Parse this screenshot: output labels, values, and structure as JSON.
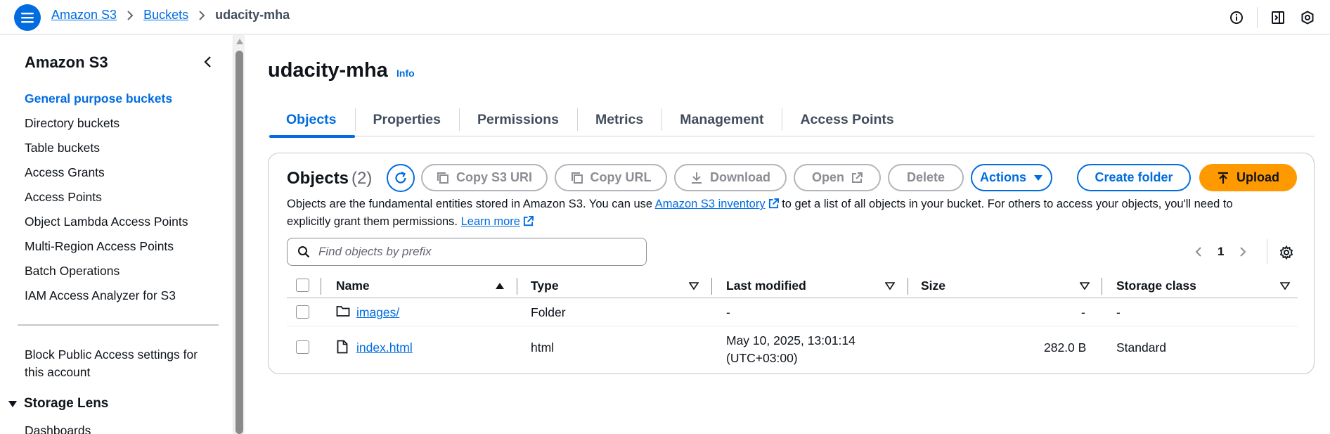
{
  "header": {
    "breadcrumb": [
      "Amazon S3",
      "Buckets"
    ],
    "breadcrumb_current": "udacity-mha",
    "icons": [
      "info-circle-icon",
      "notifications-panel-icon",
      "settings-badge-icon"
    ]
  },
  "sidebar": {
    "title": "Amazon S3",
    "items": [
      {
        "label": "General purpose buckets",
        "active": true
      },
      {
        "label": "Directory buckets"
      },
      {
        "label": "Table buckets"
      },
      {
        "label": "Access Grants"
      },
      {
        "label": "Access Points"
      },
      {
        "label": "Object Lambda Access Points"
      },
      {
        "label": "Multi-Region Access Points"
      },
      {
        "label": "Batch Operations"
      },
      {
        "label": "IAM Access Analyzer for S3"
      }
    ],
    "block_public_access": "Block Public Access settings for this account",
    "section": "Storage Lens",
    "section_items": [
      "Dashboards"
    ]
  },
  "main": {
    "bucket_name": "udacity-mha",
    "info_label": "Info",
    "tabs": [
      "Objects",
      "Properties",
      "Permissions",
      "Metrics",
      "Management",
      "Access Points"
    ],
    "active_tab": "Objects",
    "objects_title": "Objects",
    "objects_count": "(2)",
    "buttons": {
      "copy_uri": "Copy S3 URI",
      "copy_url": "Copy URL",
      "download": "Download",
      "open": "Open",
      "delete": "Delete",
      "actions": "Actions",
      "create_folder": "Create folder",
      "upload": "Upload"
    },
    "description_1": "Objects are the fundamental entities stored in Amazon S3. You can use ",
    "inventory_link": "Amazon S3 inventory",
    "description_2": " to get a list of all objects in your bucket. For others to access your objects, you'll need to explicitly grant them permissions. ",
    "learn_more": "Learn more",
    "search_placeholder": "Find objects by prefix",
    "page_number": "1",
    "columns": [
      "Name",
      "Type",
      "Last modified",
      "Size",
      "Storage class"
    ],
    "rows": [
      {
        "name": "images/",
        "icon": "folder-icon",
        "type": "Folder",
        "modified": "-",
        "modified_tz": "",
        "size": "-",
        "storage": "-"
      },
      {
        "name": "index.html",
        "icon": "file-icon",
        "type": "html",
        "modified": "May 10, 2025, 13:01:14",
        "modified_tz": "(UTC+03:00)",
        "size": "282.0 B",
        "storage": "Standard"
      }
    ]
  },
  "colors": {
    "accent": "#006ce0",
    "upload": "#ff9900",
    "border": "#c6c6cd"
  }
}
